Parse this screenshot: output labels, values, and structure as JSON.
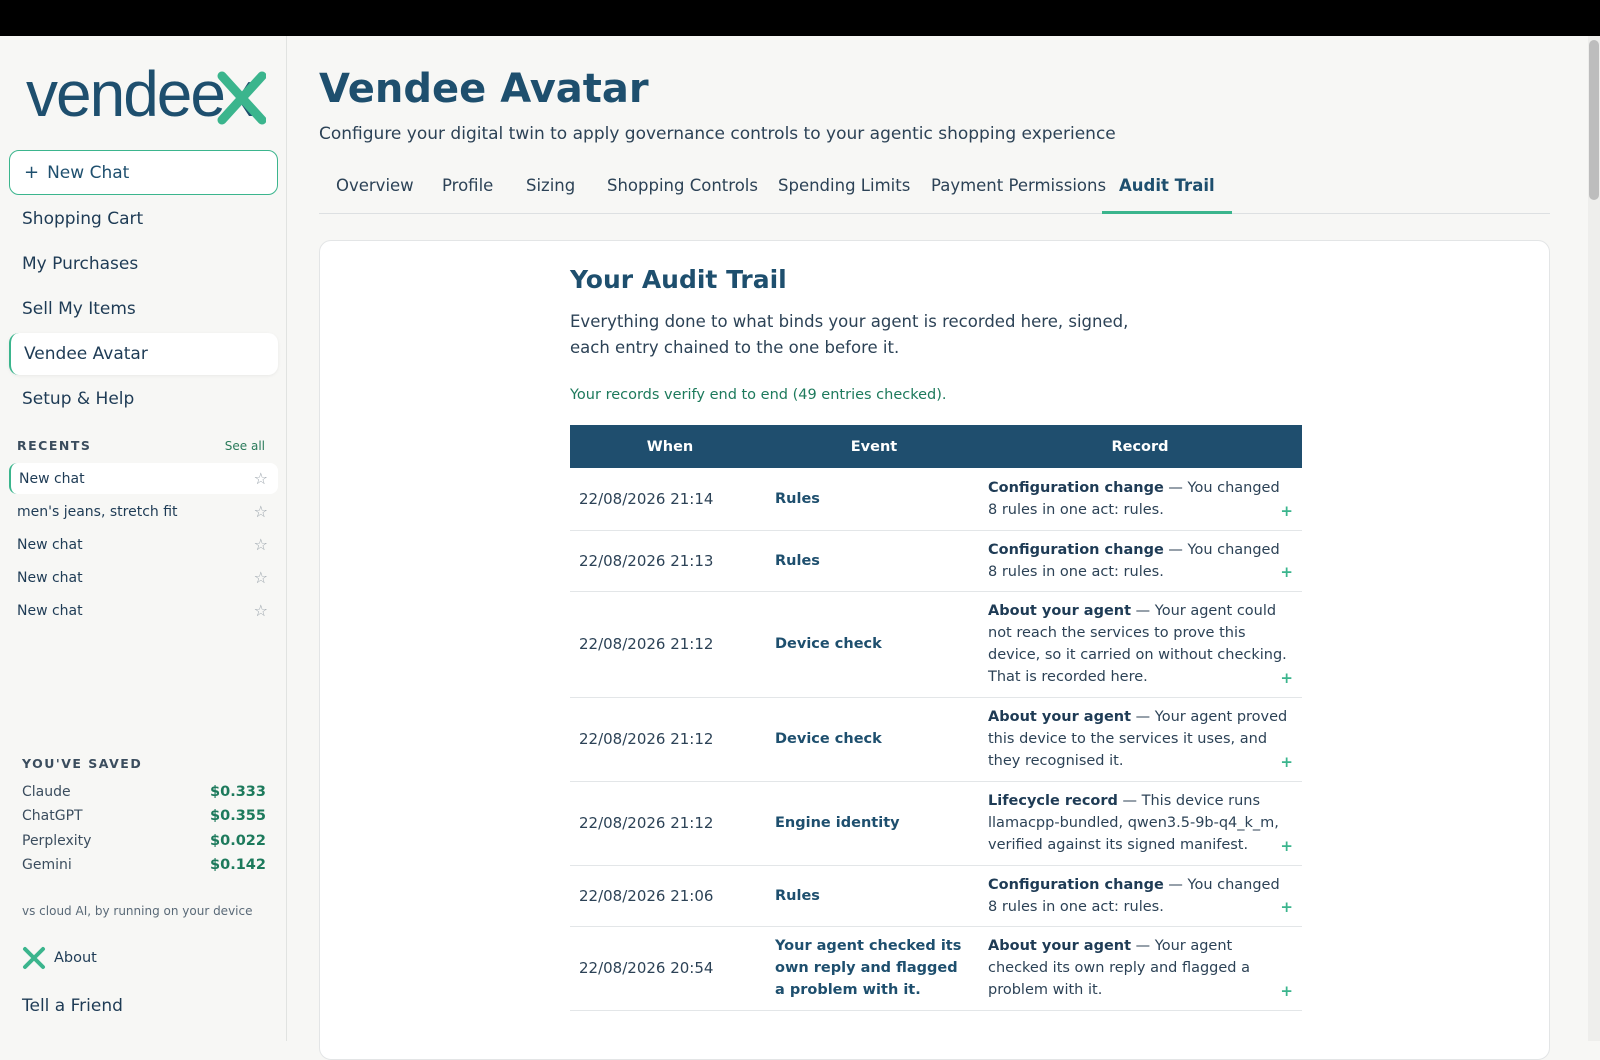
{
  "sidebar": {
    "logo_text": "vendeex",
    "new_chat_label": "New Chat",
    "nav": [
      "Shopping Cart",
      "My Purchases",
      "Sell My Items",
      "Vendee Avatar",
      "Setup & Help"
    ],
    "recents_title": "RECENTS",
    "see_all": "See all",
    "recents": [
      "New chat",
      "men's jeans, stretch fit",
      "New chat",
      "New chat",
      "New chat"
    ],
    "saved_title": "YOU'VE SAVED",
    "saved": [
      {
        "name": "Claude",
        "amount": "$0.333"
      },
      {
        "name": "ChatGPT",
        "amount": "$0.355"
      },
      {
        "name": "Perplexity",
        "amount": "$0.022"
      },
      {
        "name": "Gemini",
        "amount": "$0.142"
      }
    ],
    "saved_note": "vs cloud AI, by running on your device",
    "about_label": "About",
    "tell_friend": "Tell a Friend"
  },
  "header": {
    "title": "Vendee Avatar",
    "subtitle": "Configure your digital twin to apply governance controls to your agentic shopping experience"
  },
  "tabs": [
    "Overview",
    "Profile",
    "Sizing",
    "Shopping Controls",
    "Spending Limits",
    "Payment Permissions",
    "Audit Trail"
  ],
  "audit": {
    "title": "Your Audit Trail",
    "description": "Everything done to what binds your agent is recorded here, signed, each entry chained to the one before it.",
    "verify": "Your records verify end to end (49 entries checked).",
    "columns": [
      "When",
      "Event",
      "Record"
    ],
    "rows": [
      {
        "when": "22/08/2026 21:14",
        "event": "Rules",
        "record_head": "Configuration change",
        "record_text": " — You changed 8 rules in one act: rules.",
        "expand": "+"
      },
      {
        "when": "22/08/2026 21:13",
        "event": "Rules",
        "record_head": "Configuration change",
        "record_text": " — You changed 8 rules in one act: rules.",
        "expand": "+"
      },
      {
        "when": "22/08/2026 21:12",
        "event": "Device check",
        "record_head": "About your agent",
        "record_text": " — Your agent could not reach the services to prove this device, so it carried on without checking. That is recorded here.",
        "expand": "+"
      },
      {
        "when": "22/08/2026 21:12",
        "event": "Device check",
        "record_head": "About your agent",
        "record_text": " — Your agent proved this device to the services it uses, and they recognised it.",
        "expand": "+"
      },
      {
        "when": "22/08/2026 21:12",
        "event": "Engine identity",
        "record_head": "Lifecycle record",
        "record_text": " — This device runs llamacpp-bundled, qwen3.5-9b-q4_k_m, verified against its signed manifest.",
        "expand": "+"
      },
      {
        "when": "22/08/2026 21:06",
        "event": "Rules",
        "record_head": "Configuration change",
        "record_text": " — You changed 8 rules in one act: rules.",
        "expand": "+"
      },
      {
        "when": "22/08/2026 20:54",
        "event": "Your agent checked its own reply and flagged a problem with it.",
        "record_head": "About your agent",
        "record_text": " — Your agent checked its own reply and flagged a problem with it.",
        "expand": "+"
      }
    ]
  },
  "colors": {
    "brand": "#1e4f6e",
    "accent": "#3bb58d",
    "table_header": "#1f4e6e"
  }
}
